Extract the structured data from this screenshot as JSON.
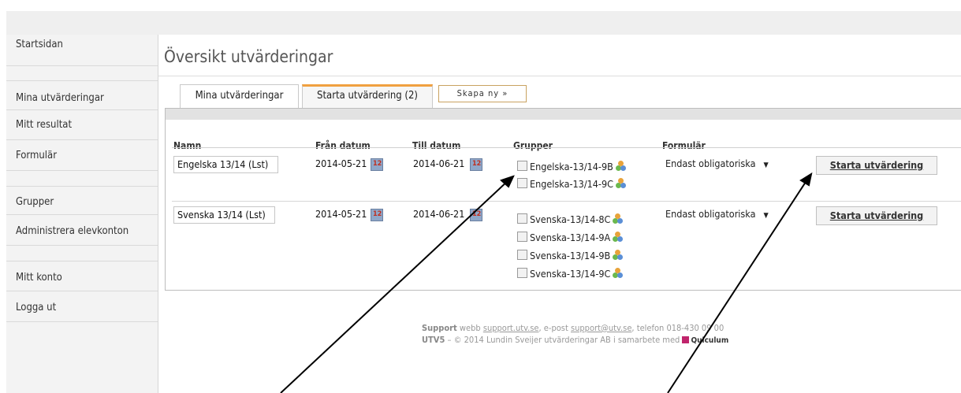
{
  "sidebar": {
    "items": [
      {
        "label": "Startsidan"
      },
      {
        "label": "Mina utvärderingar"
      },
      {
        "label": "Mitt resultat"
      },
      {
        "label": "Formulär"
      },
      {
        "label": "Grupper"
      },
      {
        "label": "Administrera elevkonton"
      },
      {
        "label": "Mitt konto"
      },
      {
        "label": "Logga ut"
      }
    ]
  },
  "page": {
    "title": "Översikt utvärderingar"
  },
  "tabs": [
    {
      "label": "Mina utvärderingar",
      "active": false
    },
    {
      "label": "Starta utvärdering (2)",
      "active": true
    },
    {
      "label": "Skapa ny »",
      "active": false
    }
  ],
  "table": {
    "headers": [
      "Namn",
      "Från datum",
      "Till datum",
      "Grupper",
      "Formulär"
    ],
    "rows": [
      {
        "name": "Engelska 13/14 (Lst)",
        "from": "2014-05-21",
        "to": "2014-06-21",
        "groups": [
          "Engelska-13/14-9B",
          "Engelska-13/14-9C"
        ],
        "form": "Endast obligatoriska",
        "action": "Starta utvärdering"
      },
      {
        "name": "Svenska 13/14 (Lst)",
        "from": "2014-05-21",
        "to": "2014-06-21",
        "groups": [
          "Svenska-13/14-8C",
          "Svenska-13/14-9A",
          "Svenska-13/14-9B",
          "Svenska-13/14-9C"
        ],
        "form": "Endast obligatoriska",
        "action": "Starta utvärdering"
      }
    ]
  },
  "footer": {
    "support_label": "Support",
    "line1_a": " webb ",
    "web_link": "support.utv.se",
    "line1_b": ", e-post ",
    "email_link": "support@utv.se",
    "line1_c": ", telefon 018-430 09 00",
    "brand": "UTV5",
    "line2": " – © 2014 Lundin Sveijer utvärderingar AB i samarbete med ",
    "partner": "Quiculum"
  },
  "colors": {
    "tab_accent": "#f0a040",
    "partner_logo": "#c0246c",
    "calendar": "#8fa7c9"
  },
  "icons": [
    "calendar-icon",
    "group-icon",
    "dropdown-arrow-icon",
    "quiculum-logo-icon"
  ]
}
